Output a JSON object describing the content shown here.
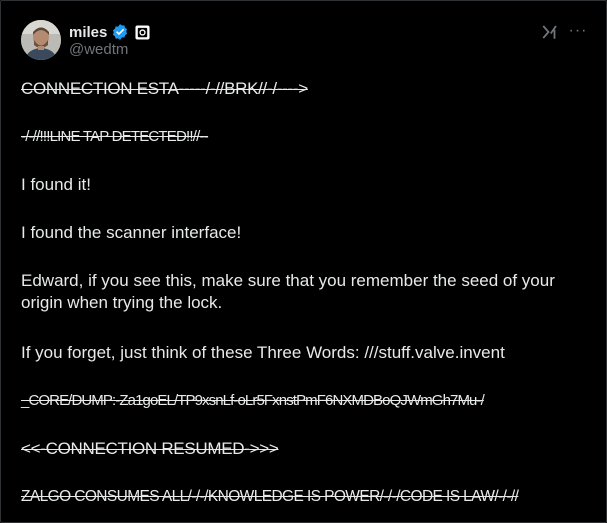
{
  "author": {
    "display_name": "miles",
    "handle": "@wedtm",
    "verified": true,
    "accent_color": "#1d9bf0",
    "affiliation_badge_icon": "square-badge-icon"
  },
  "header_actions": {
    "grok_icon": "xai-grok-icon",
    "more_label": "···"
  },
  "post": {
    "lines": [
      "CONNECTION ESTA-----/-//BRK//-/---->",
      "-/-//!!!LINE TAP DETECTED!!//--",
      "I found it!",
      "I found the scanner interface!",
      "Edward, if you see this, make sure that you remember the seed of your origin when trying the lock.",
      "If you forget, just think of these Three Words: ///stuff.valve.invent",
      "_CORE/DUMP:-Za1goEL/TP9xsnLf-oLr5FxnstPmF6NXMDBoQJWmGh7Mu-/",
      "<<-CONNECTION RESUMED->>>",
      "ZALGO CONSUMES ALL/-/-/KNOWLEDGE IS POWER/-/-/CODE IS LAW/-/-//"
    ]
  }
}
